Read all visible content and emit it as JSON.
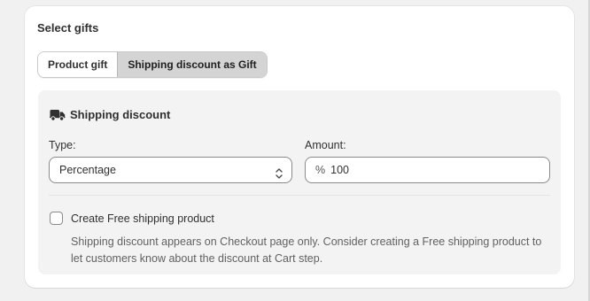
{
  "card": {
    "title": "Select gifts"
  },
  "tabs": [
    {
      "label": "Product gift",
      "active": false
    },
    {
      "label": "Shipping discount as Gift",
      "active": true
    }
  ],
  "panel": {
    "icon": "truck-icon",
    "title": "Shipping discount",
    "type_label": "Type:",
    "type_value": "Percentage",
    "amount_label": "Amount:",
    "amount_prefix": "%",
    "amount_value": "100",
    "checkbox_label": "Create Free shipping product",
    "checkbox_checked": false,
    "help_text": "Shipping discount appears on Checkout page only. Consider creating a Free shipping product to let customers know about the discount at Cart step."
  },
  "colors": {
    "page_bg": "#f1f1f1",
    "card_bg": "#ffffff",
    "panel_bg": "#f3f3f3",
    "active_tab_bg": "#d4d4d4",
    "text": "#303030",
    "subdued_text": "#616161"
  }
}
